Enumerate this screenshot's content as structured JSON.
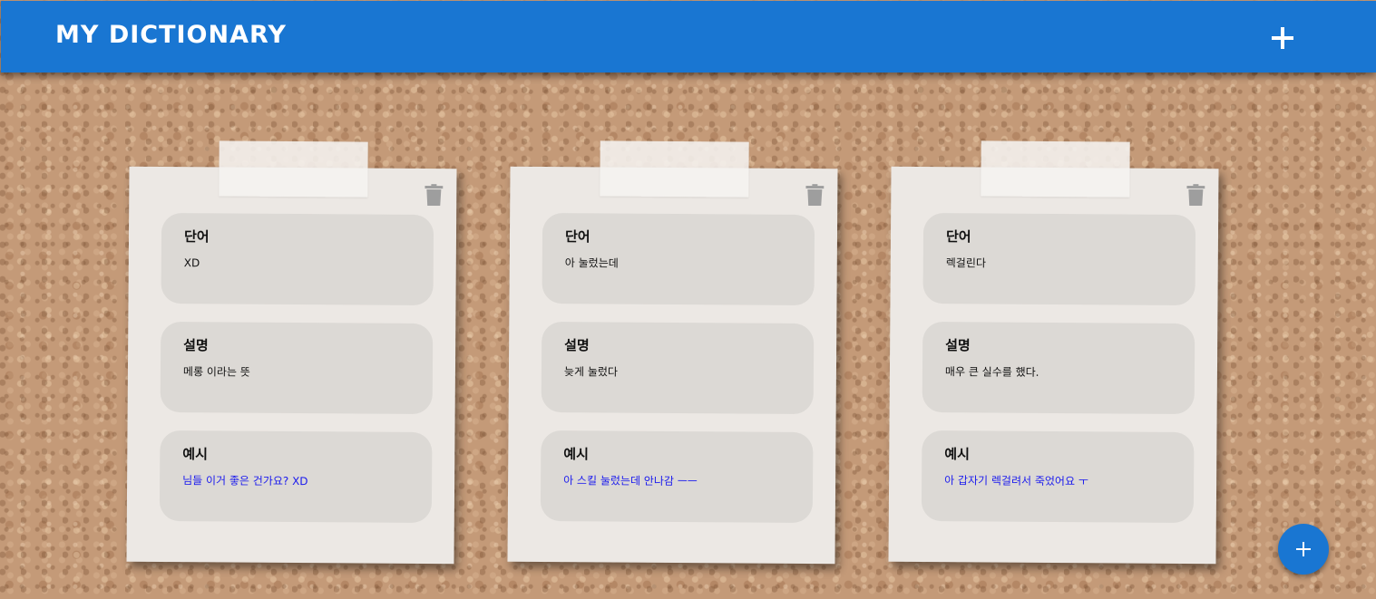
{
  "app": {
    "title": "MY DICTIONARY",
    "header_color": "#1976d2",
    "add_icon": "plus-icon"
  },
  "labels": {
    "word": "단어",
    "description": "설명",
    "example": "예시"
  },
  "cards": [
    {
      "word": "XD",
      "description": "메롱 이라는 뜻",
      "example": "님들 이거 좋은 건가요? XD"
    },
    {
      "word": "아 눌렀는데",
      "description": "늦게 눌렀다",
      "example": "아 스킬 눌렀는데 안나감 ㅡㅡ"
    },
    {
      "word": "렉걸린다",
      "description": "매우 큰 실수를 했다.",
      "example": "아 갑자기 렉걸려서 죽었어요 ㅜ"
    }
  ],
  "icons": {
    "delete": "trash-icon",
    "fab": "plus-icon"
  },
  "colors": {
    "example_text": "#1a1aee",
    "fab": "#1976d2"
  }
}
